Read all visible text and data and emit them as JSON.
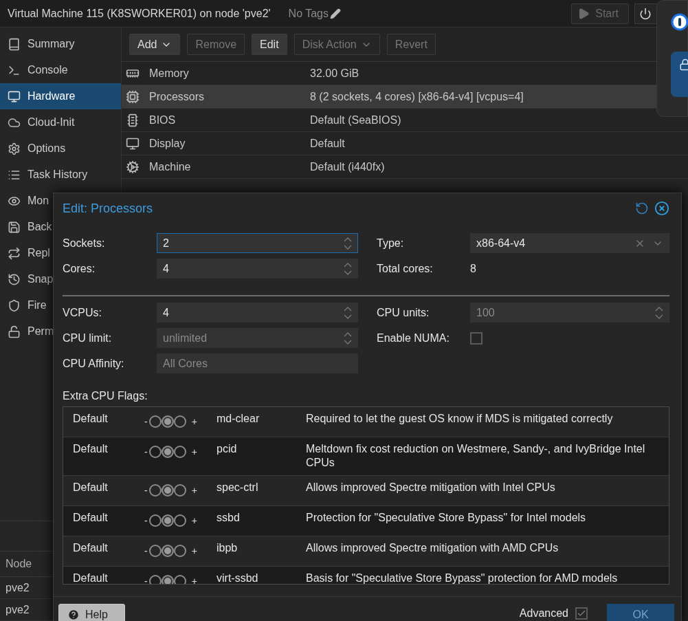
{
  "header": {
    "title": "Virtual Machine 115 (K8SWORKER01) on node 'pve2'",
    "tags": "No Tags",
    "start_button": {
      "label": "Start",
      "disabled": true
    }
  },
  "sidebar": {
    "items": [
      {
        "label": "Summary",
        "selected": false
      },
      {
        "label": "Console",
        "selected": false
      },
      {
        "label": "Hardware",
        "selected": true
      },
      {
        "label": "Cloud-Init",
        "selected": false
      },
      {
        "label": "Options",
        "selected": false
      },
      {
        "label": "Task History",
        "selected": false
      },
      {
        "label": "Mon",
        "selected": false
      },
      {
        "label": "Back",
        "selected": false
      },
      {
        "label": "Repl",
        "selected": false
      },
      {
        "label": "Snap",
        "selected": false
      },
      {
        "label": "Fire",
        "selected": false
      },
      {
        "label": "Perm",
        "selected": false
      }
    ]
  },
  "toolbar": {
    "buttons": [
      {
        "label": "Add",
        "disabled": false,
        "menu": true
      },
      {
        "label": "Remove",
        "disabled": true,
        "menu": false
      },
      {
        "label": "Edit",
        "disabled": false,
        "menu": false
      },
      {
        "label": "Disk Action",
        "disabled": true,
        "menu": true
      },
      {
        "label": "Revert",
        "disabled": true,
        "menu": false
      }
    ]
  },
  "hardware": {
    "rows": [
      {
        "name": "Memory",
        "value": "32.00 GiB",
        "selected": false
      },
      {
        "name": "Processors",
        "value": "8 (2 sockets, 4 cores) [x86-64-v4] [vcpus=4]",
        "selected": true
      },
      {
        "name": "BIOS",
        "value": "Default (SeaBIOS)",
        "selected": false
      },
      {
        "name": "Display",
        "value": "Default",
        "selected": false
      },
      {
        "name": "Machine",
        "value": "Default (i440fx)",
        "selected": false
      }
    ]
  },
  "task_log": {
    "columns": [
      "Node"
    ],
    "rows": [
      "pve2",
      "pve2"
    ]
  },
  "dialog": {
    "title": "Edit: Processors",
    "top_left": [
      {
        "label": "Sockets:",
        "kind": "spinner",
        "value": "2",
        "focused": true
      },
      {
        "label": "Cores:",
        "kind": "spinner",
        "value": "4",
        "focused": false
      }
    ],
    "top_right": [
      {
        "label": "Type:",
        "kind": "combo",
        "value": "x86-64-v4"
      },
      {
        "label": "Total cores:",
        "kind": "display",
        "value": "8"
      }
    ],
    "bottom_left": [
      {
        "label": "VCPUs:",
        "kind": "spinner",
        "value": "4",
        "focused": false
      },
      {
        "label": "CPU limit:",
        "kind": "spinner",
        "placeholder": "unlimited",
        "focused": false
      },
      {
        "label": "CPU Affinity:",
        "kind": "text",
        "placeholder": "All Cores",
        "focused": false
      }
    ],
    "bottom_right": [
      {
        "label": "CPU units:",
        "kind": "spinner",
        "placeholder": "100",
        "focused": false
      },
      {
        "label": "Enable NUMA:",
        "kind": "checkbox",
        "checked": false
      }
    ],
    "flags_label": "Extra CPU Flags:",
    "flags": [
      {
        "state": "Default",
        "minus": "-",
        "plus": "+",
        "options": [
          {
            "selected": false
          },
          {
            "selected": true
          },
          {
            "selected": false
          }
        ],
        "name": "md-clear",
        "description": "Required to let the guest OS know if MDS is mitigated correctly"
      },
      {
        "state": "Default",
        "minus": "-",
        "plus": "+",
        "options": [
          {
            "selected": false
          },
          {
            "selected": true
          },
          {
            "selected": false
          }
        ],
        "name": "pcid",
        "description": "Meltdown fix cost reduction on Westmere, Sandy-, and IvyBridge Intel CPUs"
      },
      {
        "state": "Default",
        "minus": "-",
        "plus": "+",
        "options": [
          {
            "selected": false
          },
          {
            "selected": true
          },
          {
            "selected": false
          }
        ],
        "name": "spec-ctrl",
        "description": "Allows improved Spectre mitigation with Intel CPUs"
      },
      {
        "state": "Default",
        "minus": "-",
        "plus": "+",
        "options": [
          {
            "selected": false
          },
          {
            "selected": true
          },
          {
            "selected": false
          }
        ],
        "name": "ssbd",
        "description": "Protection for \"Speculative Store Bypass\" for Intel models"
      },
      {
        "state": "Default",
        "minus": "-",
        "plus": "+",
        "options": [
          {
            "selected": false
          },
          {
            "selected": true
          },
          {
            "selected": false
          }
        ],
        "name": "ibpb",
        "description": "Allows improved Spectre mitigation with AMD CPUs"
      },
      {
        "state": "Default",
        "minus": "-",
        "plus": "+",
        "options": [
          {
            "selected": false
          },
          {
            "selected": true
          },
          {
            "selected": false
          }
        ],
        "name": "virt-ssbd",
        "description": "Basis for \"Speculative Store Bypass\" protection for AMD models"
      }
    ],
    "help_button": "Help",
    "advanced": {
      "label": "Advanced",
      "checked": true
    },
    "ok_button": "OK"
  }
}
